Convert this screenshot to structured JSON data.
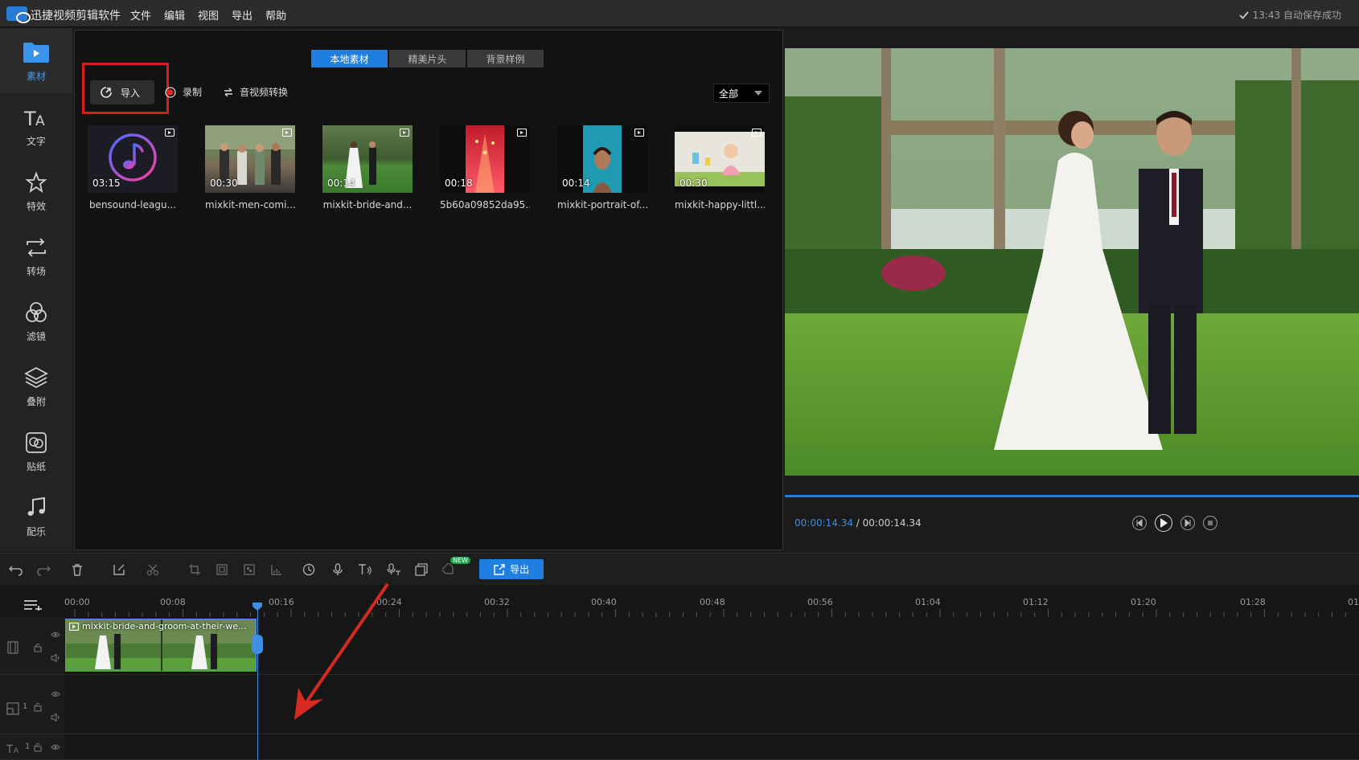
{
  "app": {
    "title": "迅捷视频剪辑软件",
    "menu": [
      "文件",
      "编辑",
      "视图",
      "导出",
      "帮助"
    ],
    "save_status": "13:43 自动保存成功"
  },
  "sidebar": {
    "items": [
      {
        "label": "素材",
        "icon": "folder-play-icon",
        "active": true
      },
      {
        "label": "文字",
        "icon": "text-icon"
      },
      {
        "label": "特效",
        "icon": "star-effect-icon"
      },
      {
        "label": "转场",
        "icon": "transition-icon"
      },
      {
        "label": "滤镜",
        "icon": "filter-icon"
      },
      {
        "label": "叠附",
        "icon": "layers-icon"
      },
      {
        "label": "贴纸",
        "icon": "sticker-icon"
      },
      {
        "label": "配乐",
        "icon": "music-icon"
      }
    ]
  },
  "media": {
    "tabs": [
      "本地素材",
      "精美片头",
      "背景样例"
    ],
    "active_tab": "本地素材",
    "import_label": "导入",
    "record_label": "录制",
    "convert_label": "音视频转换",
    "filter_value": "全部",
    "items": [
      {
        "name": "bensound-leagu...",
        "duration": "03:15",
        "type": "audio"
      },
      {
        "name": "mixkit-men-comi...",
        "duration": "00:30",
        "type": "video"
      },
      {
        "name": "mixkit-bride-and...",
        "duration": "00:14",
        "type": "video"
      },
      {
        "name": "5b60a09852da95...",
        "duration": "00:18",
        "type": "video"
      },
      {
        "name": "mixkit-portrait-of...",
        "duration": "00:14",
        "type": "video"
      },
      {
        "name": "mixkit-happy-littl...",
        "duration": "00:30",
        "type": "video"
      }
    ]
  },
  "player": {
    "current_time": "00:00:14.34",
    "separator": " / ",
    "total_time": "00:00:14.34",
    "progress": 1.0
  },
  "toolbar": {
    "export_label": "导出",
    "new_badge": "NEW"
  },
  "timeline": {
    "ticks": [
      "00:00",
      "00:08",
      "00:16",
      "00:24",
      "00:32",
      "00:40",
      "00:48",
      "00:56",
      "01:04",
      "01:12",
      "01:20",
      "01:28",
      "01"
    ],
    "clip_label": "mixkit-bride-and-groom-at-their-we...",
    "track_numbers": [
      "1",
      "1"
    ]
  },
  "colors": {
    "accent": "#1f7fe0",
    "highlight": "#d71d1d",
    "annotation_arrow": "#d42a22"
  }
}
